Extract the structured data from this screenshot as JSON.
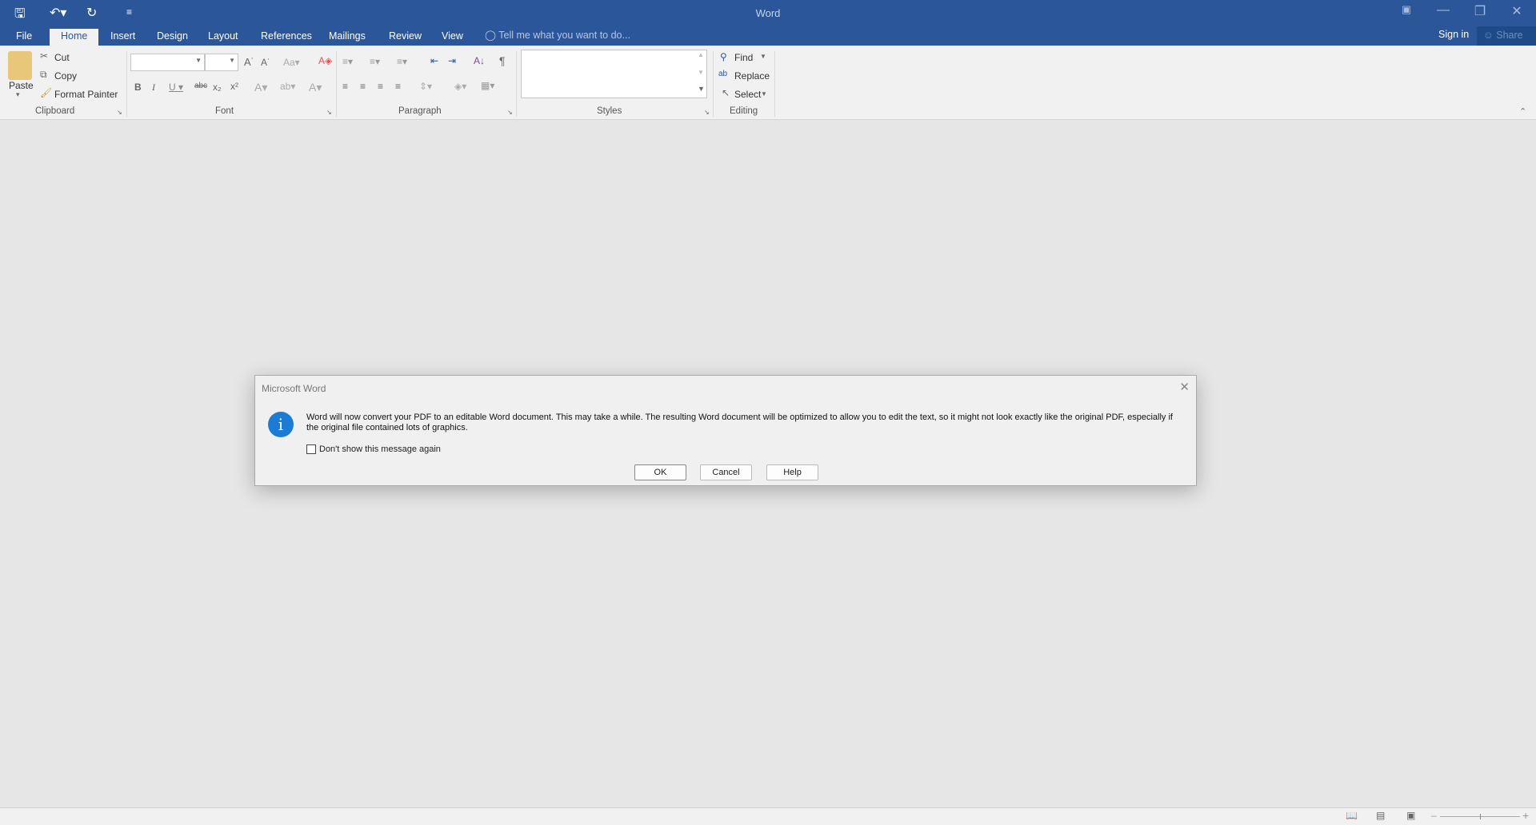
{
  "app": {
    "title": "Word"
  },
  "qat": {
    "save": "save-icon",
    "undo": "undo-icon",
    "redo": "redo-icon",
    "customize": "customize-icon"
  },
  "tabs": [
    {
      "label": "File"
    },
    {
      "label": "Home",
      "active": true
    },
    {
      "label": "Insert"
    },
    {
      "label": "Design"
    },
    {
      "label": "Layout"
    },
    {
      "label": "References"
    },
    {
      "label": "Mailings"
    },
    {
      "label": "Review"
    },
    {
      "label": "View"
    }
  ],
  "tellme": "Tell me what you want to do...",
  "signin": "Sign in",
  "share": "Share",
  "clipboard": {
    "paste": "Paste",
    "cut": "Cut",
    "copy": "Copy",
    "format_painter": "Format Painter",
    "label": "Clipboard"
  },
  "font": {
    "label": "Font",
    "font_name": "",
    "font_size": ""
  },
  "paragraph": {
    "label": "Paragraph"
  },
  "styles": {
    "label": "Styles"
  },
  "editing": {
    "find": "Find",
    "replace": "Replace",
    "select": "Select",
    "label": "Editing"
  },
  "dialog": {
    "title": "Microsoft Word",
    "message": "Word will now convert your PDF to an editable Word document. This may take a while. The resulting Word document will be optimized to allow you to edit the text, so it might not look exactly like the original PDF, especially if the original file contained lots of graphics.",
    "checkbox_label": "Don't show this message again",
    "checkbox_checked": false,
    "ok": "OK",
    "cancel": "Cancel",
    "help": "Help"
  },
  "colors": {
    "accent": "#2b579a",
    "info": "#1c7cd5"
  }
}
